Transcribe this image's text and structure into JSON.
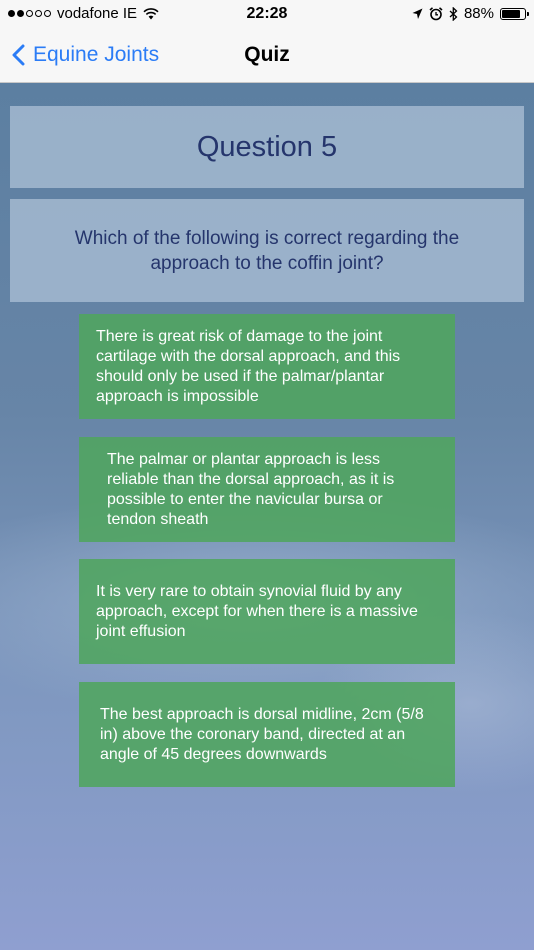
{
  "status_bar": {
    "carrier": "vodafone IE",
    "time": "22:28",
    "battery_percent": "88%",
    "battery_level": 0.88,
    "signal_bars_filled": 2,
    "signal_bars_total": 5,
    "icons": [
      "wifi-icon",
      "location-arrow-icon",
      "alarm-clock-icon",
      "bluetooth-icon",
      "battery-icon"
    ]
  },
  "nav": {
    "back_label": "Equine Joints",
    "title": "Quiz"
  },
  "quiz": {
    "question_number": "Question 5",
    "question_text": "Which of the following is correct regarding the approach to the coffin joint?",
    "answers": [
      "There is great risk of damage to the joint cartilage with the dorsal approach, and this should only be used if the palmar/plantar approach is impossible",
      "The palmar or plantar approach is less reliable than the dorsal approach, as it is possible to enter the navicular bursa or tendon sheath",
      "It is very rare to obtain synovial fluid by any approach, except for when there is a massive joint effusion",
      "The best approach is dorsal midline, 2cm (5/8 in) above the coronary band, directed at an angle of 45 degrees downwards"
    ]
  },
  "colors": {
    "accent": "#2b7cf6",
    "panel_text": "#25356c",
    "answer_bg": "#50a55f",
    "answer_text": "#ffffff"
  }
}
